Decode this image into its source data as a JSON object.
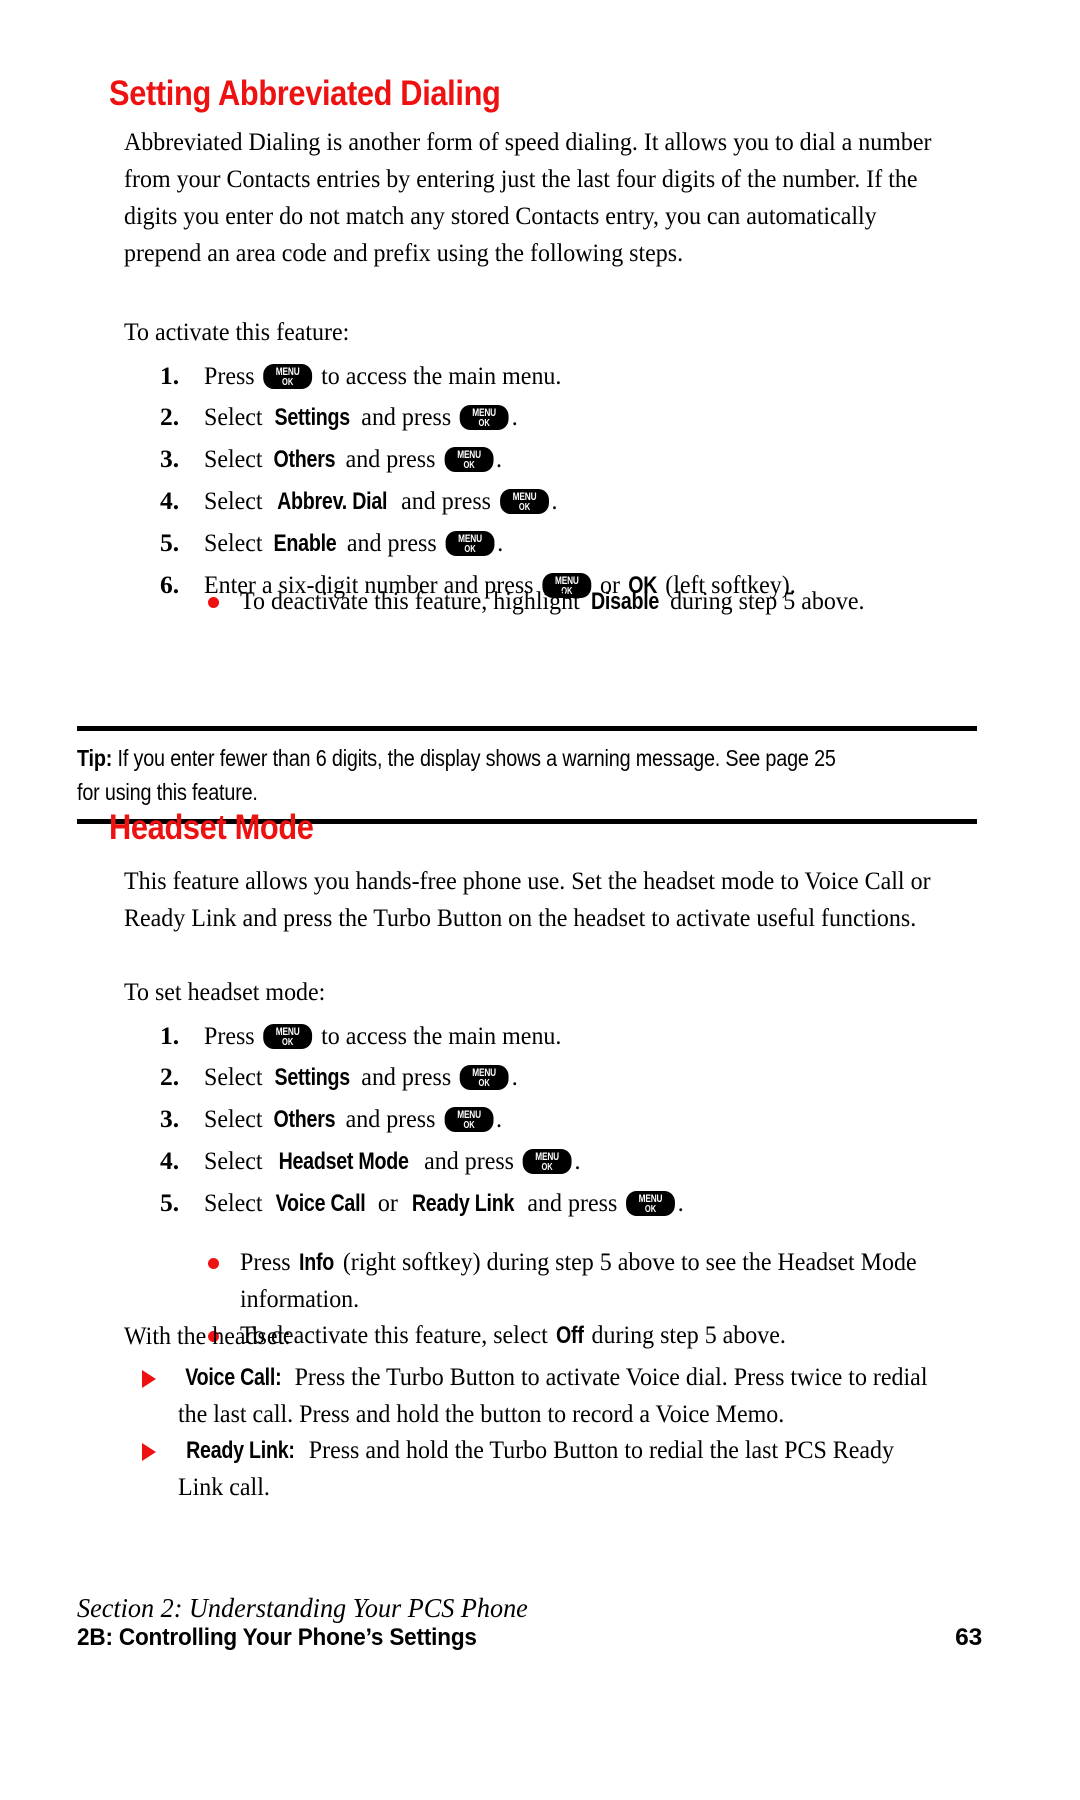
{
  "sections": [
    {
      "title": "Setting Abbreviated Dialing",
      "paragraph": "Abbreviated Dialing is another form of speed dialing. It allows you to dial a number from your Contacts entries by entering just the last four digits of the number. If the digits you enter do not match any stored Contacts entry, you can automatically prepend an area code and prefix using the following steps.",
      "lead_in": "To activate this feature:"
    },
    {
      "title": "Headset Mode",
      "paragraph": "This feature allows you hands-free phone use. Set the headset mode to Voice Call or Ready Link and press the Turbo Button on the headset to activate useful functions.",
      "lead_in": "To set headset mode:",
      "lead_in_2": "With the headset:"
    }
  ],
  "keycap": {
    "line1": "MENU",
    "line2": "OK"
  },
  "steps_1": [
    {
      "num": "1.",
      "pre": "Press ",
      "key": true,
      "post": " to access the main menu."
    },
    {
      "num": "2.",
      "pre": "Select ",
      "bold": "Settings",
      "mid": " and press ",
      "key": true,
      "post": "."
    },
    {
      "num": "3.",
      "pre": "Select ",
      "bold": "Others",
      "mid": " and press ",
      "key": true,
      "post": "."
    },
    {
      "num": "4.",
      "pre": "Select ",
      "bold": "Abbrev. Dial",
      "mid": " and press ",
      "key": true,
      "post": "."
    },
    {
      "num": "5.",
      "pre": "Select ",
      "bold": "Enable",
      "mid": " and press ",
      "key": true,
      "post": "."
    },
    {
      "num": "6.",
      "pre": "Enter a six-digit number and press ",
      "key": true,
      "mid": " or ",
      "bold2": "OK",
      "post": " (left softkey)."
    }
  ],
  "subbullets_1": [
    {
      "pre": "To deactivate this feature, highlight ",
      "bold": "Disable",
      "post": " during step 5 above."
    }
  ],
  "steps_2": [
    {
      "num": "1.",
      "pre": "Press ",
      "key": true,
      "post": " to access the main menu."
    },
    {
      "num": "2.",
      "pre": "Select ",
      "bold": "Settings",
      "mid": " and press ",
      "key": true,
      "post": "."
    },
    {
      "num": "3.",
      "pre": "Select ",
      "bold": "Others",
      "mid": " and press ",
      "key": true,
      "post": "."
    },
    {
      "num": "4.",
      "pre": "Select ",
      "bold": "Headset Mode",
      "mid": " and press ",
      "key": true,
      "post": "."
    },
    {
      "num": "5.",
      "pre": "Select ",
      "bold": "Voice Call",
      "mid": " or ",
      "bold2": "Ready Link",
      "mid2": " and press ",
      "key": true,
      "post": "."
    }
  ],
  "subbullets_2": [
    {
      "pre": "Press ",
      "bold": "Info",
      "post": " (right softkey) during step 5 above to see the Headset Mode information."
    },
    {
      "pre": "To deactivate this feature, select ",
      "bold": "Off",
      "post": " during step 5 above."
    }
  ],
  "arrow_items": [
    {
      "bold": "Voice Call:",
      "text": " Press the Turbo Button to activate Voice dial. Press twice to redial the last call. Press and hold the button to record a Voice Memo."
    },
    {
      "bold": "Ready Link:",
      "text": " Press and hold the Turbo Button to redial the last PCS Ready Link call."
    }
  ],
  "tip": {
    "label": "Tip:",
    "text": " If you enter fewer than 6 digits, the display shows a warning message. See page 25 for using this feature."
  },
  "footer": {
    "section_line": "Section 2: Understanding Your PCS Phone",
    "chapter_line": "2B: Controlling Your Phone’s Settings",
    "page_number": "63"
  },
  "colors": {
    "heading_red": "#ee1111",
    "bullet_red": "#ee1111",
    "rule_black": "#000000",
    "text_black": "#000000"
  }
}
